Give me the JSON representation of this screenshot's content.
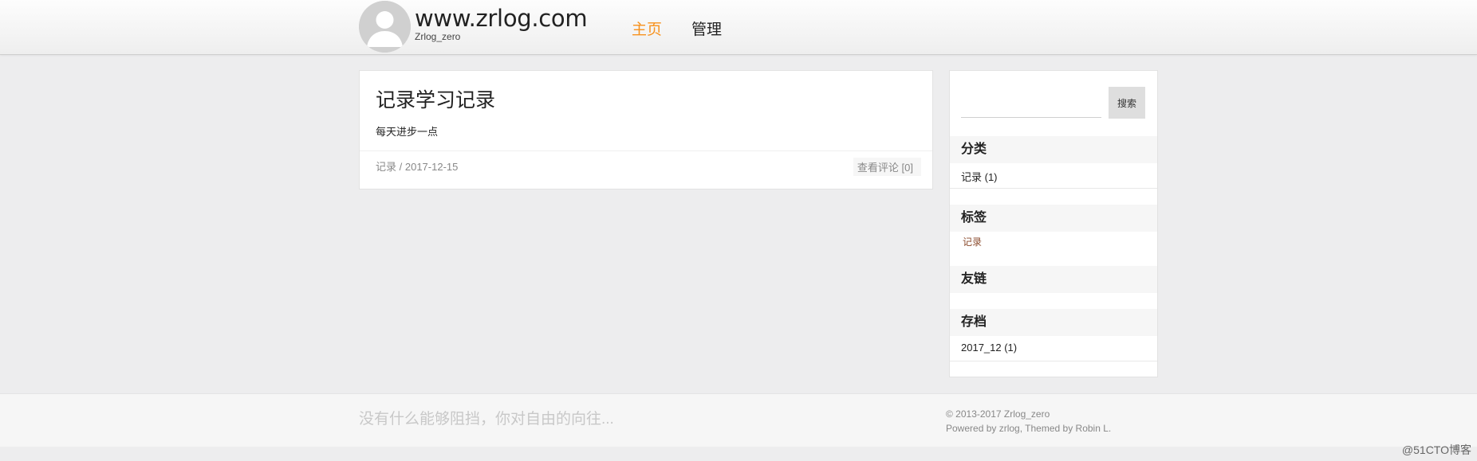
{
  "header": {
    "site_title": "www.zrlog.com",
    "site_subtitle": "Zrlog_zero",
    "nav": {
      "home": "主页",
      "admin": "管理"
    }
  },
  "post": {
    "title": "记录学习记录",
    "summary": "每天进步一点",
    "category": "记录",
    "meta_sep": " / ",
    "date": "2017-12-15",
    "comments": "查看评论 [0]"
  },
  "sidebar": {
    "search": {
      "placeholder": "",
      "button": "搜索"
    },
    "categories": {
      "title": "分类",
      "items": [
        "记录 (1)"
      ]
    },
    "tags": {
      "title": "标签",
      "items": [
        "记录"
      ]
    },
    "links": {
      "title": "友链"
    },
    "archives": {
      "title": "存档",
      "items": [
        "2017_12 (1)"
      ]
    }
  },
  "footer": {
    "motto": "没有什么能够阻挡，你对自由的向往...",
    "copyright": "© 2013-2017 Zrlog_zero",
    "powered": "Powered by zrlog, Themed by Robin L."
  },
  "watermark": "@51CTO博客",
  "colors": {
    "accent": "#f7921e",
    "tag": "#8a4a2c"
  },
  "icons": {
    "avatar": "default-user-avatar-icon"
  }
}
